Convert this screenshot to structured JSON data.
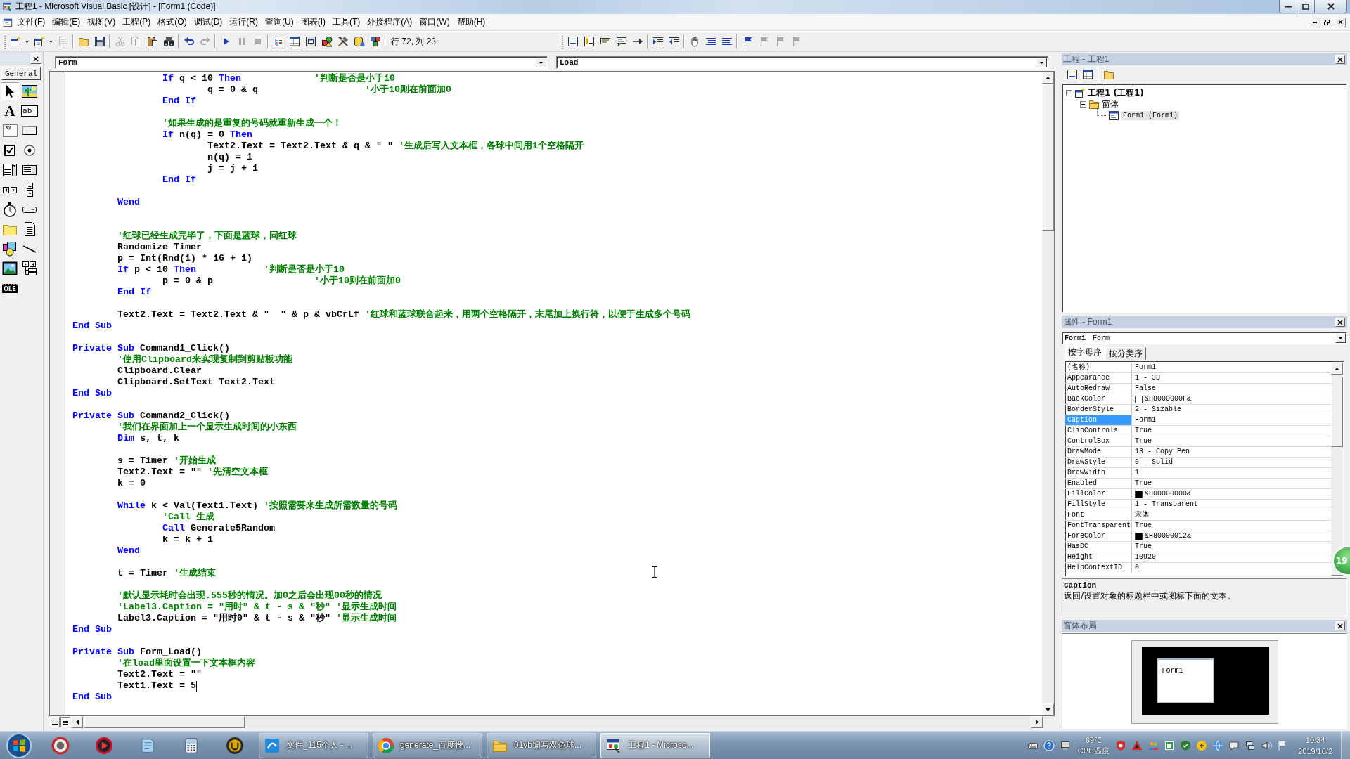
{
  "window": {
    "title": "工程1 - Microsoft Visual Basic [设计] - [Form1 (Code)]"
  },
  "menu": [
    "文件(F)",
    "编辑(E)",
    "视图(V)",
    "工程(P)",
    "格式(O)",
    "调试(D)",
    "运行(R)",
    "查询(U)",
    "图表(I)",
    "工具(T)",
    "外接程序(A)",
    "窗口(W)",
    "帮助(H)"
  ],
  "toolbar": {
    "left": [
      [
        {
          "kind": "add-project",
          "disabled": false
        },
        {
          "kind": "dropdown",
          "disabled": false
        },
        {
          "kind": "add-form",
          "disabled": false
        },
        {
          "kind": "dropdown",
          "disabled": false
        },
        {
          "kind": "menu-editor",
          "disabled": true
        }
      ],
      [
        {
          "kind": "open",
          "disabled": false
        },
        {
          "kind": "save",
          "disabled": false
        }
      ],
      [
        {
          "kind": "cut",
          "disabled": true
        },
        {
          "kind": "copy",
          "disabled": true
        },
        {
          "kind": "paste",
          "disabled": false
        },
        {
          "kind": "find",
          "disabled": false
        }
      ],
      [
        {
          "kind": "undo",
          "disabled": false
        },
        {
          "kind": "redo",
          "disabled": true
        }
      ],
      [
        {
          "kind": "run",
          "disabled": false
        },
        {
          "kind": "pause",
          "disabled": true
        },
        {
          "kind": "stop",
          "disabled": true
        }
      ],
      [
        {
          "kind": "project-explorer",
          "disabled": false
        },
        {
          "kind": "properties",
          "disabled": false
        },
        {
          "kind": "form-layout",
          "disabled": false
        },
        {
          "kind": "object-browser",
          "disabled": false
        },
        {
          "kind": "toolbox",
          "disabled": false
        },
        {
          "kind": "data-view",
          "disabled": false
        },
        {
          "kind": "component-manager",
          "disabled": false
        }
      ]
    ],
    "position": "行 72, 列 23",
    "right": [
      [
        {
          "kind": "list-members",
          "disabled": false
        },
        {
          "kind": "list-constants",
          "disabled": false
        },
        {
          "kind": "quick-info",
          "disabled": false
        },
        {
          "kind": "parameter-info",
          "disabled": false
        },
        {
          "kind": "complete-word",
          "disabled": false
        }
      ],
      [
        {
          "kind": "indent",
          "disabled": false
        },
        {
          "kind": "outdent",
          "disabled": false
        }
      ],
      [
        {
          "kind": "breakpoint",
          "disabled": false
        },
        {
          "kind": "comment-block",
          "disabled": false
        },
        {
          "kind": "uncomment-block",
          "disabled": false
        }
      ],
      [
        {
          "kind": "bookmark",
          "disabled": false
        },
        {
          "kind": "next-bookmark",
          "disabled": true
        },
        {
          "kind": "previous-bookmark",
          "disabled": true
        },
        {
          "kind": "clear-bookmarks",
          "disabled": true
        }
      ]
    ]
  },
  "toolbox": {
    "tab": "General",
    "tools": [
      {
        "kind": "pointer",
        "selected": true
      },
      {
        "kind": "picture-box",
        "selected": false
      },
      {
        "kind": "label",
        "glyph": "A",
        "selected": false
      },
      {
        "kind": "text-box",
        "glyph": "ab|",
        "selected": false
      },
      {
        "kind": "frame",
        "glyph": "xy",
        "selected": false
      },
      {
        "kind": "command-button",
        "selected": false
      },
      {
        "kind": "check-box",
        "selected": false
      },
      {
        "kind": "option-button",
        "selected": false
      },
      {
        "kind": "combo-box",
        "selected": false
      },
      {
        "kind": "list-box",
        "selected": false
      },
      {
        "kind": "h-scroll",
        "selected": false
      },
      {
        "kind": "v-scroll",
        "selected": false
      },
      {
        "kind": "timer",
        "selected": false
      },
      {
        "kind": "drive-list",
        "selected": false
      },
      {
        "kind": "dir-list",
        "selected": false
      },
      {
        "kind": "file-list",
        "selected": false
      },
      {
        "kind": "shape",
        "selected": false
      },
      {
        "kind": "line",
        "selected": false
      },
      {
        "kind": "image",
        "selected": false
      },
      {
        "kind": "data",
        "selected": false
      },
      {
        "kind": "ole",
        "glyph": "OLE",
        "selected": false
      }
    ]
  },
  "code_window": {
    "object": "Form",
    "procedure": "Load",
    "ibeam_pointer": true,
    "lines": [
      {
        "kind": "code",
        "segments": [
          {
            "kind": "keyword",
            "text": "                If"
          },
          {
            "kind": "code",
            "text": " q < 10 "
          },
          {
            "kind": "keyword",
            "text": "Then"
          },
          {
            "kind": "comment",
            "text": "             '判断是否是小于10"
          }
        ]
      },
      {
        "kind": "code",
        "segments": [
          {
            "kind": "code",
            "text": "                        q = 0 & q"
          },
          {
            "kind": "comment",
            "text": "                   '小于10则在前面加0"
          }
        ]
      },
      {
        "kind": "code",
        "segments": [
          {
            "kind": "keyword",
            "text": "                End If"
          }
        ]
      },
      {
        "kind": "blank"
      },
      {
        "kind": "code",
        "segments": [
          {
            "kind": "comment",
            "text": "                '如果生成的是重复的号码就重新生成一个！"
          }
        ]
      },
      {
        "kind": "code",
        "segments": [
          {
            "kind": "keyword",
            "text": "                If"
          },
          {
            "kind": "code",
            "text": " n(q) = 0 "
          },
          {
            "kind": "keyword",
            "text": "Then"
          }
        ]
      },
      {
        "kind": "code",
        "segments": [
          {
            "kind": "code",
            "text": "                        Text2.Text = Text2.Text & q & \" \" "
          },
          {
            "kind": "comment",
            "text": "'生成后写入文本框，各球中间用1个空格隔开"
          }
        ]
      },
      {
        "kind": "code",
        "segments": [
          {
            "kind": "code",
            "text": "                        n(q) = 1"
          }
        ]
      },
      {
        "kind": "code",
        "segments": [
          {
            "kind": "code",
            "text": "                        j = j + 1"
          }
        ]
      },
      {
        "kind": "code",
        "segments": [
          {
            "kind": "keyword",
            "text": "                End If"
          }
        ]
      },
      {
        "kind": "blank"
      },
      {
        "kind": "code",
        "segments": [
          {
            "kind": "keyword",
            "text": "        Wend"
          }
        ]
      },
      {
        "kind": "blank"
      },
      {
        "kind": "blank"
      },
      {
        "kind": "code",
        "segments": [
          {
            "kind": "comment",
            "text": "        '红球已经生成完毕了，下面是蓝球，同红球"
          }
        ]
      },
      {
        "kind": "code",
        "segments": [
          {
            "kind": "code",
            "text": "        Randomize Timer"
          }
        ]
      },
      {
        "kind": "code",
        "segments": [
          {
            "kind": "code",
            "text": "        p = Int(Rnd(1) * 16 + 1)"
          }
        ]
      },
      {
        "kind": "code",
        "segments": [
          {
            "kind": "keyword",
            "text": "        If"
          },
          {
            "kind": "code",
            "text": " p < 10 "
          },
          {
            "kind": "keyword",
            "text": "Then"
          },
          {
            "kind": "comment",
            "text": "            '判断是否是小于10"
          }
        ]
      },
      {
        "kind": "code",
        "segments": [
          {
            "kind": "code",
            "text": "                p = 0 & p"
          },
          {
            "kind": "comment",
            "text": "                  '小于10则在前面加0"
          }
        ]
      },
      {
        "kind": "code",
        "segments": [
          {
            "kind": "keyword",
            "text": "        End If"
          }
        ]
      },
      {
        "kind": "blank"
      },
      {
        "kind": "code",
        "segments": [
          {
            "kind": "code",
            "text": "        Text2.Text = Text2.Text & \"  \" & p & vbCrLf "
          },
          {
            "kind": "comment",
            "text": "'红球和蓝球联合起来，用两个空格隔开，末尾加上换行符，以便于生成多个号码"
          }
        ]
      },
      {
        "kind": "code",
        "segments": [
          {
            "kind": "keyword",
            "text": "End Sub"
          }
        ]
      },
      {
        "kind": "blank"
      },
      {
        "kind": "code",
        "segments": [
          {
            "kind": "keyword",
            "text": "Private Sub"
          },
          {
            "kind": "code",
            "text": " Command1_Click()"
          }
        ]
      },
      {
        "kind": "code",
        "segments": [
          {
            "kind": "comment",
            "text": "        '使用Clipboard来实现复制到剪贴板功能"
          }
        ]
      },
      {
        "kind": "code",
        "segments": [
          {
            "kind": "code",
            "text": "        Clipboard.Clear"
          }
        ]
      },
      {
        "kind": "code",
        "segments": [
          {
            "kind": "code",
            "text": "        Clipboard.SetText Text2.Text"
          }
        ]
      },
      {
        "kind": "code",
        "segments": [
          {
            "kind": "keyword",
            "text": "End Sub"
          }
        ]
      },
      {
        "kind": "blank"
      },
      {
        "kind": "code",
        "segments": [
          {
            "kind": "keyword",
            "text": "Private Sub"
          },
          {
            "kind": "code",
            "text": " Command2_Click()"
          }
        ]
      },
      {
        "kind": "code",
        "segments": [
          {
            "kind": "comment",
            "text": "        '我们在界面加上一个显示生成时间的小东西"
          }
        ]
      },
      {
        "kind": "code",
        "segments": [
          {
            "kind": "keyword",
            "text": "        Dim"
          },
          {
            "kind": "code",
            "text": " s, t, k"
          }
        ]
      },
      {
        "kind": "blank"
      },
      {
        "kind": "code",
        "segments": [
          {
            "kind": "code",
            "text": "        s = Timer "
          },
          {
            "kind": "comment",
            "text": "'开始生成"
          }
        ]
      },
      {
        "kind": "code",
        "segments": [
          {
            "kind": "code",
            "text": "        Text2.Text = \"\" "
          },
          {
            "kind": "comment",
            "text": "'先清空文本框"
          }
        ]
      },
      {
        "kind": "code",
        "segments": [
          {
            "kind": "code",
            "text": "        k = 0"
          }
        ]
      },
      {
        "kind": "blank"
      },
      {
        "kind": "code",
        "segments": [
          {
            "kind": "keyword",
            "text": "        While"
          },
          {
            "kind": "code",
            "text": " k < Val(Text1.Text) "
          },
          {
            "kind": "comment",
            "text": "'按照需要来生成所需数量的号码"
          }
        ]
      },
      {
        "kind": "code",
        "segments": [
          {
            "kind": "comment",
            "text": "                'Call 生成"
          }
        ]
      },
      {
        "kind": "code",
        "segments": [
          {
            "kind": "keyword",
            "text": "                Call"
          },
          {
            "kind": "code",
            "text": " Generate5Random"
          }
        ]
      },
      {
        "kind": "code",
        "segments": [
          {
            "kind": "code",
            "text": "                k = k + 1"
          }
        ]
      },
      {
        "kind": "code",
        "segments": [
          {
            "kind": "keyword",
            "text": "        Wend"
          }
        ]
      },
      {
        "kind": "blank"
      },
      {
        "kind": "code",
        "segments": [
          {
            "kind": "code",
            "text": "        t = Timer "
          },
          {
            "kind": "comment",
            "text": "'生成结束"
          }
        ]
      },
      {
        "kind": "blank"
      },
      {
        "kind": "code",
        "segments": [
          {
            "kind": "comment",
            "text": "        '默认显示耗时会出现.555秒的情况。加0之后会出现00秒的情况"
          }
        ]
      },
      {
        "kind": "code",
        "segments": [
          {
            "kind": "comment",
            "text": "        'Label3.Caption = \"用时\" & t - s & \"秒\" '显示生成时间"
          }
        ]
      },
      {
        "kind": "code",
        "segments": [
          {
            "kind": "code",
            "text": "        Label3.Caption = \"用时0\" & t - s & \"秒\" "
          },
          {
            "kind": "comment",
            "text": "'显示生成时间"
          }
        ]
      },
      {
        "kind": "code",
        "segments": [
          {
            "kind": "keyword",
            "text": "End Sub"
          }
        ]
      },
      {
        "kind": "blank"
      },
      {
        "kind": "code",
        "segments": [
          {
            "kind": "keyword",
            "text": "Private Sub"
          },
          {
            "kind": "code",
            "text": " Form_Load()"
          }
        ]
      },
      {
        "kind": "code",
        "segments": [
          {
            "kind": "comment",
            "text": "        '在load里面设置一下文本框内容"
          }
        ]
      },
      {
        "kind": "code",
        "segments": [
          {
            "kind": "code",
            "text": "        Text2.Text = \"\""
          }
        ]
      },
      {
        "kind": "code",
        "segments": [
          {
            "kind": "code",
            "text": "        Text1.Text = 5"
          },
          {
            "kind": "caret"
          }
        ]
      },
      {
        "kind": "code",
        "segments": [
          {
            "kind": "keyword",
            "text": "End Sub"
          }
        ]
      }
    ]
  },
  "project": {
    "title": "工程 - 工程1",
    "toolbar": [
      {
        "kind": "view-code"
      },
      {
        "kind": "view-object"
      },
      {
        "kind": "toggle-folders"
      }
    ],
    "tree": [
      {
        "kind": "project",
        "label": "工程1 (工程1)",
        "expanded": true,
        "selected": false,
        "children": [
          {
            "kind": "folder",
            "label": "窗体",
            "expanded": true,
            "selected": false,
            "children": [
              {
                "kind": "form",
                "label": "Form1 (Form1)",
                "selected": true
              }
            ]
          }
        ]
      }
    ]
  },
  "properties": {
    "title": "属性 - Form1",
    "object": {
      "name": "Form1",
      "type": "Form"
    },
    "tabs": [
      {
        "label": "按字母序",
        "selected": true
      },
      {
        "label": "按分类序",
        "selected": false
      }
    ],
    "rows": [
      {
        "name": "(名称)",
        "value": "Form1",
        "selected": false
      },
      {
        "name": "Appearance",
        "value": "1 - 3D",
        "selected": false
      },
      {
        "name": "AutoRedraw",
        "value": "False",
        "selected": false
      },
      {
        "name": "BackColor",
        "value": "&H8000000F&",
        "color": "#ffffff",
        "selected": false
      },
      {
        "name": "BorderStyle",
        "value": "2 - Sizable",
        "selected": false
      },
      {
        "name": "Caption",
        "value": "Form1",
        "selected": true
      },
      {
        "name": "ClipControls",
        "value": "True",
        "selected": false
      },
      {
        "name": "ControlBox",
        "value": "True",
        "selected": false
      },
      {
        "name": "DrawMode",
        "value": "13 - Copy Pen",
        "selected": false
      },
      {
        "name": "DrawStyle",
        "value": "0 - Solid",
        "selected": false
      },
      {
        "name": "DrawWidth",
        "value": "1",
        "selected": false
      },
      {
        "name": "Enabled",
        "value": "True",
        "selected": false
      },
      {
        "name": "FillColor",
        "value": "&H00000000&",
        "color": "#000000",
        "selected": false
      },
      {
        "name": "FillStyle",
        "value": "1 - Transparent",
        "selected": false
      },
      {
        "name": "Font",
        "value": "宋体",
        "selected": false
      },
      {
        "name": "FontTransparent",
        "value": "True",
        "selected": false
      },
      {
        "name": "ForeColor",
        "value": "&H80000012&",
        "color": "#000000",
        "selected": false
      },
      {
        "name": "HasDC",
        "value": "True",
        "selected": false
      },
      {
        "name": "Height",
        "value": "10920",
        "selected": false
      },
      {
        "name": "HelpContextID",
        "value": "0",
        "selected": false
      }
    ],
    "description": {
      "title": "Caption",
      "text": "返回/设置对象的标题栏中或图标下面的文本。"
    }
  },
  "form_layout": {
    "title": "窗体布局",
    "form": "Form1"
  },
  "taskbar": {
    "pinned": [
      {
        "kind": "ring"
      },
      {
        "kind": "player"
      },
      {
        "kind": "notebook"
      },
      {
        "kind": "calculator"
      },
      {
        "kind": "gold-disc"
      }
    ],
    "windows": [
      {
        "kind": "blue-tile",
        "label": "文件_115个人 - ...",
        "selected": false
      },
      {
        "kind": "color-ring",
        "label": "generate_百度搜...",
        "selected": false
      },
      {
        "kind": "folder",
        "label": "01vb编写双色球...",
        "selected": false
      },
      {
        "kind": "form-window",
        "label": "工程1 - Microso...",
        "selected": true
      }
    ],
    "tray_left": [
      {
        "kind": "keyboard"
      },
      {
        "kind": "help"
      },
      {
        "kind": "display"
      }
    ],
    "temperature": {
      "value": "69℃",
      "label": "CPU温度"
    },
    "tray_right": [
      {
        "kind": "red-shield"
      },
      {
        "kind": "triangle"
      },
      {
        "kind": "people"
      },
      {
        "kind": "green-square"
      },
      {
        "kind": "shield"
      },
      {
        "kind": "yellow"
      },
      {
        "kind": "globe"
      },
      {
        "kind": "chat"
      },
      {
        "kind": "network"
      },
      {
        "kind": "speaker"
      },
      {
        "kind": "flag"
      }
    ],
    "clock": {
      "time": "10:34",
      "date": "2019/10/2"
    }
  },
  "floating_widget": {
    "label": "19"
  }
}
